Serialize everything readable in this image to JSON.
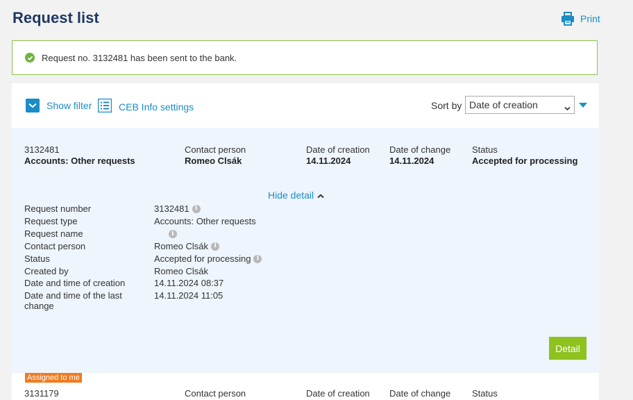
{
  "page": {
    "title": "Request list",
    "print_label": "Print"
  },
  "alert": {
    "message": "Request no. 3132481 has been sent to the bank."
  },
  "toolbar": {
    "show_filter": "Show filter",
    "ceb_settings": "CEB Info settings",
    "sort_label": "Sort by",
    "sort_value": "Date of creation"
  },
  "request1": {
    "number": "3132481",
    "type": "Accounts: Other requests",
    "contact_label": "Contact person",
    "contact": "Romeo Clsák",
    "created_label": "Date of creation",
    "created": "14.11.2024",
    "changed_label": "Date of change",
    "changed": "14.11.2024",
    "status_label": "Status",
    "status": "Accepted for processing",
    "hide_detail": "Hide detail",
    "details": {
      "number_k": "Request number",
      "number_v": "3132481",
      "type_k": "Request type",
      "type_v": "Accounts: Other requests",
      "name_k": "Request name",
      "name_v": "",
      "contact_k": "Contact person",
      "contact_v": "Romeo Clsák",
      "status_k": "Status",
      "status_v": "Accepted for processing",
      "createdby_k": "Created by",
      "createdby_v": "Romeo Clsák",
      "createdat_k": "Date and time of creation",
      "createdat_v": "14.11.2024 08:37",
      "changedat_k": "Date and time of the last change",
      "changedat_v": "14.11.2024 11:05"
    },
    "detail_button": "Detail"
  },
  "request2": {
    "badge": "Assigned to me",
    "number": "3131179",
    "contact_label": "Contact person",
    "created_label": "Date of creation",
    "changed_label": "Date of change",
    "status_label": "Status"
  },
  "colors": {
    "accent": "#1a8cc8",
    "title": "#1f3864",
    "success": "#8bc34a",
    "button": "#8dc21f",
    "badge": "#f07b22"
  },
  "icons": {
    "print": "printer-icon",
    "success": "check-circle-icon",
    "filter": "chevron-down-icon",
    "settings": "list-icon",
    "info": "info-icon"
  }
}
